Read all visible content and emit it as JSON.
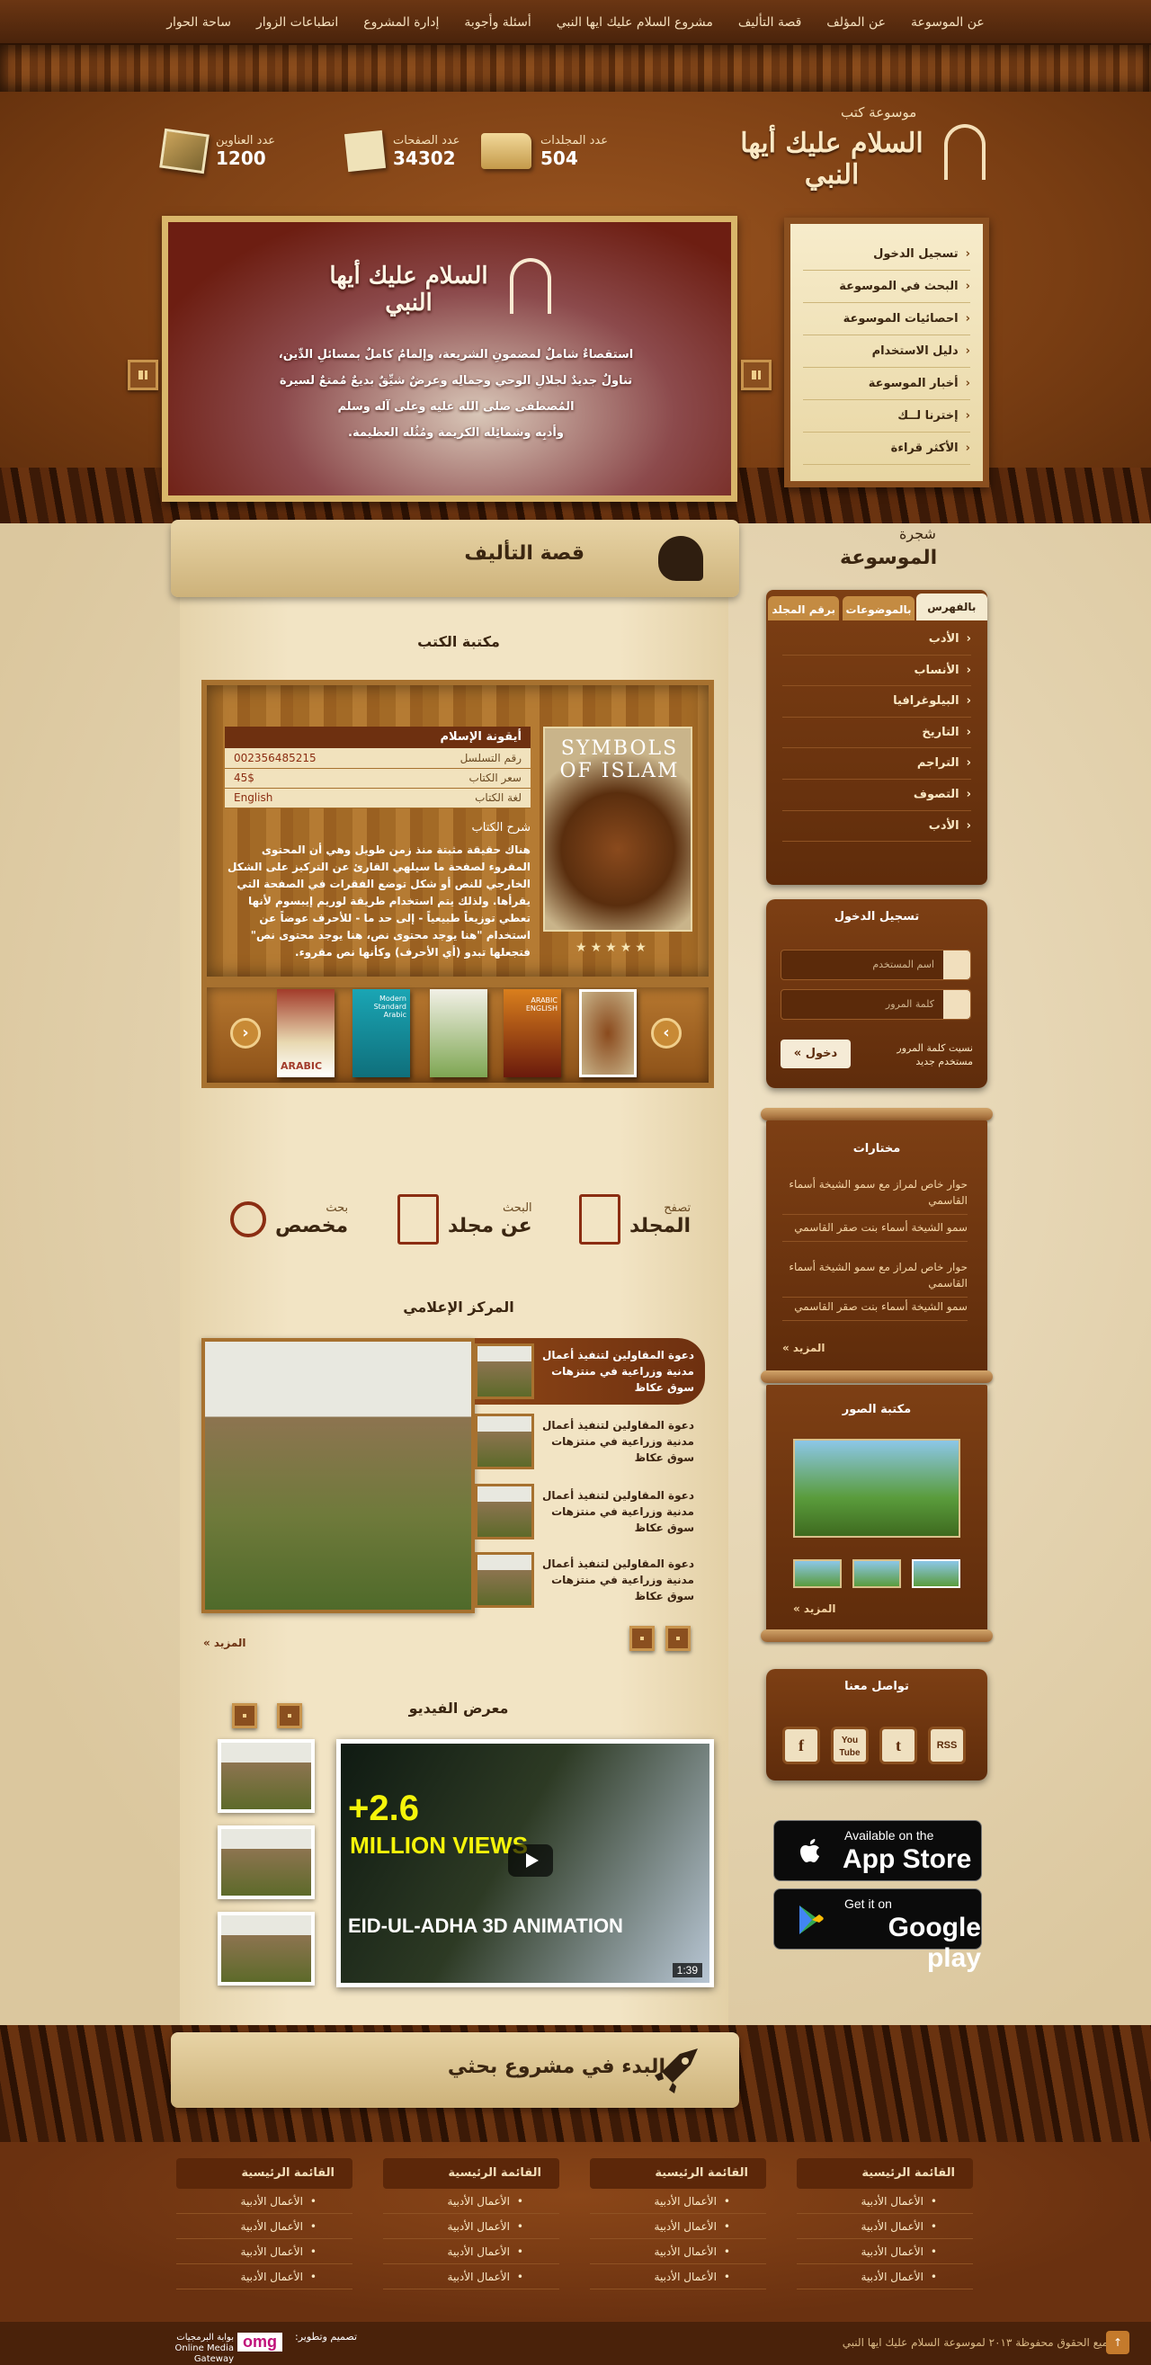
{
  "nav": {
    "items": [
      "عن الموسوعة",
      "عن المؤلف",
      "قصة التأليف",
      "مشروع السلام عليك ايها النبي",
      "أسئلة وأجوبة",
      "إدارة المشروع",
      "انطباعات الزوار",
      "ساحة الحوار"
    ]
  },
  "logo": {
    "subtitle": "موسوعة كتب",
    "title": "السلام عليك أيها النبي"
  },
  "stats": [
    {
      "label": "عدد المجلدات",
      "value": "504",
      "icon": "folder-icon"
    },
    {
      "label": "عدد الصفحات",
      "value": "34302",
      "icon": "pages-icon"
    },
    {
      "label": "عدد العناوين",
      "value": "1200",
      "icon": "photos-icon"
    }
  ],
  "slider": {
    "title": "السلام عليك أيها النبي",
    "lines": [
      "استقصاءٌ شاملٌ لمضمونِ الشريعة، وإلمامٌ كاملٌ بمسائلِ الدِّين،",
      "تناولٌ جديدٌ لجلالِ الوحي وجمالِه وعرضٌ شيِّقٌ بديعٌ مُمتعٌ لسيرة",
      "المُصطفى صلى الله عليه وعلى آله وسلم",
      "وأدبِه وشمائِله الكريمة ومُثُله العظيمة."
    ]
  },
  "quickmenu": [
    "تسجيل الدخول",
    "البحث في الموسوعة",
    "احصائيات الموسوعة",
    "دليل الاستخدام",
    "أخبار الموسوعة",
    "إخترنا لــك",
    "الأكثر قراءة"
  ],
  "story": {
    "title": "قصة التأليف"
  },
  "library": {
    "section_title": "مكتبة الكتب",
    "book": {
      "name": "أيقونة الإسلام",
      "cover_text": "SYMBOLS OF ISLAM",
      "rows": [
        {
          "k": "رقم التسلسل",
          "v": "002356485215"
        },
        {
          "k": "سعر الكتاب",
          "v": "45$"
        },
        {
          "k": "لغة الكتاب",
          "v": "English"
        }
      ],
      "desc_label": "شرح الكتاب",
      "desc": "هناك حقيقة مثبتة منذ زمن طويل وهي أن المحتوى المقروء لصفحة ما سيلهي القارئ عن التركيز على الشكل الخارجي للنص أو شكل توضع الفقرات في الصفحة التي يقرأها. ولذلك يتم استخدام طريقة لوريم إيبسوم لأنها تعطي توزيعاً طبيعياً - إلى حد ما - للأحرف عوضاً عن استخدام \"هنا يوجد محتوى نص، هنا يوجد محتوى نص\" فتجعلها تبدو (أي الأحرف) وكأنها نص مقروء.",
      "rating": 5
    },
    "thumbs": [
      "ARABIC",
      "Modern Standard Arabic",
      "",
      "ARABIC ENGLISH",
      ""
    ]
  },
  "search_opts": [
    {
      "l1": "تصفح",
      "l2": "المجلد",
      "icon": "document-icon"
    },
    {
      "l1": "البحث",
      "l2": "عن مجلد",
      "icon": "document-search-icon"
    },
    {
      "l1": "بحث",
      "l2": "مخصص",
      "icon": "magnifier-gear-icon"
    }
  ],
  "media": {
    "section_title": "المركز الإعلامي",
    "items": [
      "دعوة المقاولين لتنفيذ أعمال مدنية وزراعية في منتزهات سوق عكاظ",
      "دعوة المقاولين لتنفيذ أعمال مدنية وزراعية في منتزهات سوق عكاظ",
      "دعوة المقاولين لتنفيذ أعمال مدنية وزراعية في منتزهات سوق عكاظ",
      "دعوة المقاولين لتنفيذ أعمال مدنية وزراعية في منتزهات سوق عكاظ"
    ],
    "more": "المزيد »"
  },
  "video": {
    "section_title": "معرض الفيديو",
    "big1": "2.6+",
    "big2": "MILLION VIEWS",
    "big3": "EID-UL-ADHA 3D ANIMATION",
    "duration": "1:39"
  },
  "tree": {
    "title_a": "شجرة",
    "title_b": "الموسوعة",
    "tabs": [
      "بالفهرس",
      "بالموضوعات",
      "برقم المجلد"
    ],
    "items": [
      "الأدب",
      "الأنساب",
      "البيلوغرافيا",
      "التاريخ",
      "التراجم",
      "التصوف",
      "الأدب"
    ]
  },
  "login": {
    "title": "تسجيل الدخول",
    "user_placeholder": "اسم المستخدم",
    "pass_placeholder": "كلمة المرور",
    "button": "دخول »",
    "forgot": "نسيت كلمة المرور",
    "new_user": "مستخدم جديد"
  },
  "selected": {
    "title": "مختارات",
    "items": [
      "حوار خاص لمراز مع سمو الشيخة أسماء القاسمي",
      "سمو الشيخة أسماء بنت صقر القاسمي",
      "حوار خاص لمراز مع سمو الشيخة أسماء القاسمي",
      "سمو الشيخة أسماء بنت صقر القاسمي"
    ],
    "more": "المزيد »"
  },
  "gallery": {
    "title": "مكتبة الصور",
    "more": "المزيد »"
  },
  "contact": {
    "title": "تواصل معنا",
    "icons": [
      "facebook-icon",
      "youtube-icon",
      "twitter-icon",
      "rss-icon"
    ],
    "labels": [
      "f",
      "You Tube",
      "t",
      "RSS"
    ]
  },
  "apps": [
    {
      "small": "Available on the",
      "big": "App Store",
      "icon": "apple-icon"
    },
    {
      "small": "Get it on",
      "big": "Google play",
      "icon": "google-play-icon"
    }
  ],
  "start": {
    "title": "البدء في مشروع بحثي"
  },
  "footer": {
    "cols": [
      {
        "head": "القائمة الرئيسية",
        "items": [
          "الأعمال الأدبية",
          "الأعمال الأدبية",
          "الأعمال الأدبية",
          "الأعمال الأدبية"
        ]
      },
      {
        "head": "القائمة الرئيسية",
        "items": [
          "الأعمال الأدبية",
          "الأعمال الأدبية",
          "الأعمال الأدبية",
          "الأعمال الأدبية"
        ]
      },
      {
        "head": "القائمة الرئيسية",
        "items": [
          "الأعمال الأدبية",
          "الأعمال الأدبية",
          "الأعمال الأدبية",
          "الأعمال الأدبية"
        ]
      },
      {
        "head": "القائمة الرئيسية",
        "items": [
          "الأعمال الأدبية",
          "الأعمال الأدبية",
          "الأعمال الأدبية",
          "الأعمال الأدبية"
        ]
      }
    ],
    "copyright": "جميع الحقوق محفوظة ٢٠١٣ لموسوعة السلام عليك ايها النبي",
    "design": "تصميم وتطوير:",
    "brand": "omg",
    "gateway": "بوابة البرمجيات Online Media Gateway"
  }
}
